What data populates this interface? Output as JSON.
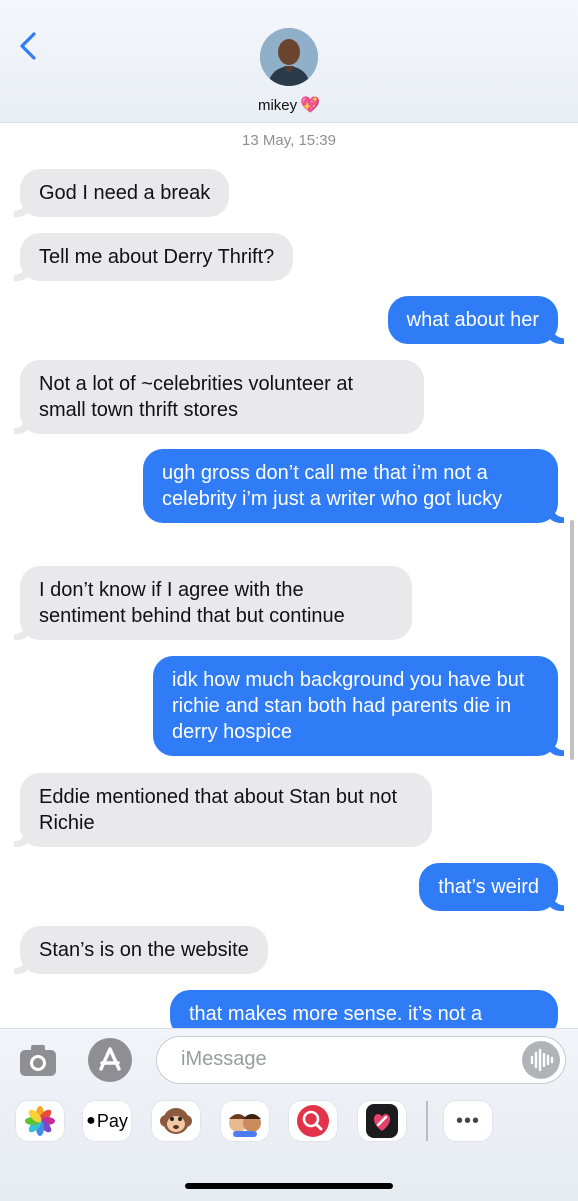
{
  "header": {
    "back_icon": "chevron-left-icon",
    "contact_name": "mikey",
    "name_emoji": "💖"
  },
  "conversation": {
    "timestamp_date": "13 May,",
    "timestamp_time": "15:39",
    "messages": [
      {
        "direction": "incoming",
        "text": "God I need a break"
      },
      {
        "direction": "incoming",
        "text": "Tell me about Derry Thrift?"
      },
      {
        "direction": "outgoing",
        "text": "what about her"
      },
      {
        "direction": "incoming",
        "text": "Not a lot of ~celebrities volunteer at small town thrift stores"
      },
      {
        "direction": "outgoing",
        "text": "ugh gross don’t call me that i’m not a celebrity i’m just a writer who got lucky"
      },
      {
        "direction": "incoming",
        "text": "I don’t know if I agree with the sentiment behind that but continue"
      },
      {
        "direction": "outgoing",
        "text": "idk how much background you have but richie and stan both had parents die in derry hospice"
      },
      {
        "direction": "incoming",
        "text": "Eddie mentioned that about Stan but not Richie"
      },
      {
        "direction": "outgoing",
        "text": "that’s weird"
      },
      {
        "direction": "incoming",
        "text": "Stan’s is on the website"
      },
      {
        "direction": "outgoing",
        "text": "that makes more sense. it’s not a"
      }
    ]
  },
  "composer": {
    "placeholder": "iMessage",
    "camera_icon": "camera-icon",
    "apps_icon": "app-store-icon",
    "mic_icon": "audio-waveform-icon"
  },
  "app_drawer": [
    {
      "name": "photos-icon"
    },
    {
      "name": "apple-pay-icon",
      "label": "Pay"
    },
    {
      "name": "monkey-memoji-icon"
    },
    {
      "name": "memoji-stickers-icon"
    },
    {
      "name": "web-search-icon"
    },
    {
      "name": "digital-touch-icon"
    },
    {
      "name": "more-apps-icon",
      "label": "•••"
    }
  ],
  "colors": {
    "outgoing_bubble": "#2f7cf6",
    "incoming_bubble": "#e9e9eb",
    "back_chevron": "#2f7cf6"
  }
}
